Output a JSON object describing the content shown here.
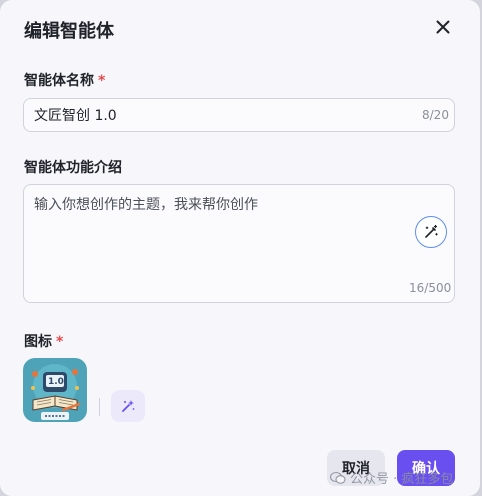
{
  "dialog": {
    "title": "编辑智能体",
    "close_icon": "close-icon"
  },
  "name_field": {
    "label": "智能体名称",
    "required_mark": "*",
    "value": "文匠智创 1.0",
    "counter": "8/20"
  },
  "description_field": {
    "label": "智能体功能介绍",
    "value": "输入你想创作的主题，我来帮你创作",
    "counter": "16/500",
    "generate_icon": "magic-wand-icon"
  },
  "icon_field": {
    "label": "图标",
    "required_mark": "*",
    "badge_text": "1.0",
    "ai_generate_icon": "sparkle-icon"
  },
  "footer": {
    "cancel_label": "取消",
    "confirm_label": "确认"
  },
  "watermark": {
    "text": "公众号 · 疯狂多包"
  },
  "colors": {
    "accent": "#6a4ff0",
    "required": "#e5484d",
    "wand_border": "#5b8ef5"
  }
}
